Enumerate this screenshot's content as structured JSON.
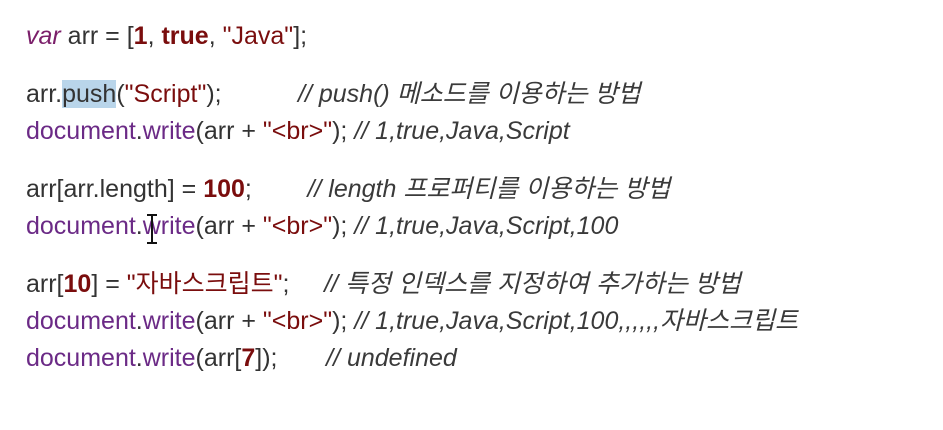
{
  "lines": {
    "l1": {
      "kw": "var",
      "p1": " arr = [",
      "n1": "1",
      "p2": ", ",
      "b1": "true",
      "p3": ", ",
      "s1": "\"Java\"",
      "p4": "];"
    },
    "l2": {
      "p1": "arr.",
      "m1": "push",
      "p2": "(",
      "s1": "\"Script\"",
      "p3": ");",
      "gap": "           ",
      "c1": "// push() 메소드를 이용하는 방법"
    },
    "l3": {
      "o1": "document",
      "p1": ".",
      "f1": "write",
      "p2": "(arr + ",
      "s1": "\"<br>\"",
      "p3": "); ",
      "c1": "// 1,true,Java,Script"
    },
    "l4": {
      "p1": "arr[arr.",
      "m1": "length",
      "p2": "] = ",
      "n1": "100",
      "p3": ";",
      "gap": "        ",
      "c1": "// length 프로퍼티를 이용하는 방법"
    },
    "l5": {
      "o1": "document",
      "p1": ".",
      "f1": "write",
      "p2": "(arr + ",
      "s1": "\"<br>\"",
      "p3": "); ",
      "c1": "// 1,true,Java,Script,100"
    },
    "l6": {
      "p1": "arr[",
      "n1": "10",
      "p2": "] = ",
      "s1": "\"자바스크립트\"",
      "p3": ";",
      "gap": "     ",
      "c1": "// 특정 인덱스를 지정하여 추가하는 방법"
    },
    "l7": {
      "o1": "document",
      "p1": ".",
      "f1": "write",
      "p2": "(arr + ",
      "s1": "\"<br>\"",
      "p3": "); ",
      "c1": "// 1,true,Java,Script,100,,,,,,자바스크립트"
    },
    "l8": {
      "o1": "document",
      "p1": ".",
      "f1": "write",
      "p2": "(arr[",
      "n1": "7",
      "p3": "]);",
      "gap": "       ",
      "c1": "// undefined"
    }
  },
  "colors": {
    "keyword": "#7b1f6a",
    "number": "#7a0d0d",
    "string": "#7a0d0d",
    "object": "#6b2a86",
    "comment": "#3a3a3a",
    "selection": "#b9d5ea"
  },
  "icons": {
    "cursor": "text-ibeam-cursor-icon"
  }
}
